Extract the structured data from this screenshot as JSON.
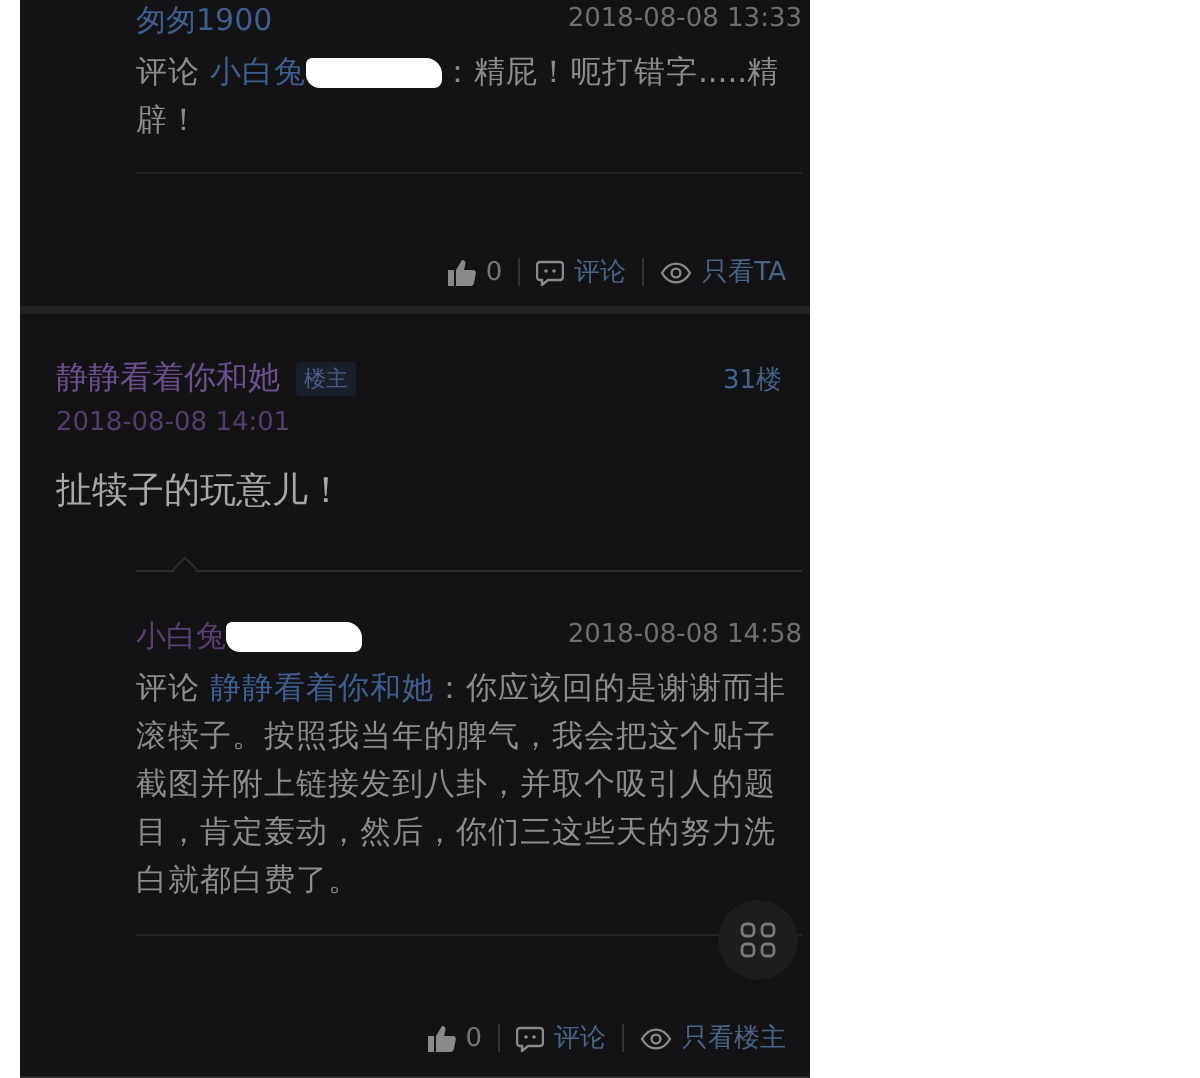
{
  "top_reply": {
    "author": "匆匆1900",
    "author_redacted": false,
    "time": "2018-08-08 13:33",
    "comment_label": "评论",
    "target": "小白兔",
    "target_redacted": true,
    "text": "：精屁！呃打错字.....精辟！",
    "actions": [
      {
        "kind": "like",
        "label": "0"
      },
      {
        "kind": "comment",
        "label": "评论"
      },
      {
        "kind": "view",
        "label": "只看TA"
      }
    ]
  },
  "post": {
    "author": "静静看着你和她",
    "badge": "楼主",
    "floor": "31楼",
    "date": "2018-08-08 14:01",
    "content": "扯犊子的玩意儿！",
    "reply": {
      "author": "小白兔",
      "author_redacted": true,
      "time": "2018-08-08 14:58",
      "comment_label": "评论",
      "target": "静静看着你和她",
      "target_redacted": false,
      "text": "：你应该回的是谢谢而非滚犊子。按照我当年的脾气，我会把这个贴子截图并附上链接发到八卦，并取个吸引人的题目，肯定轰动，然后，你们三这些天的努力洗白就都白费了。"
    },
    "actions": [
      {
        "kind": "like",
        "label": "0"
      },
      {
        "kind": "comment",
        "label": "评论"
      },
      {
        "kind": "view",
        "label": "只看楼主"
      }
    ]
  }
}
